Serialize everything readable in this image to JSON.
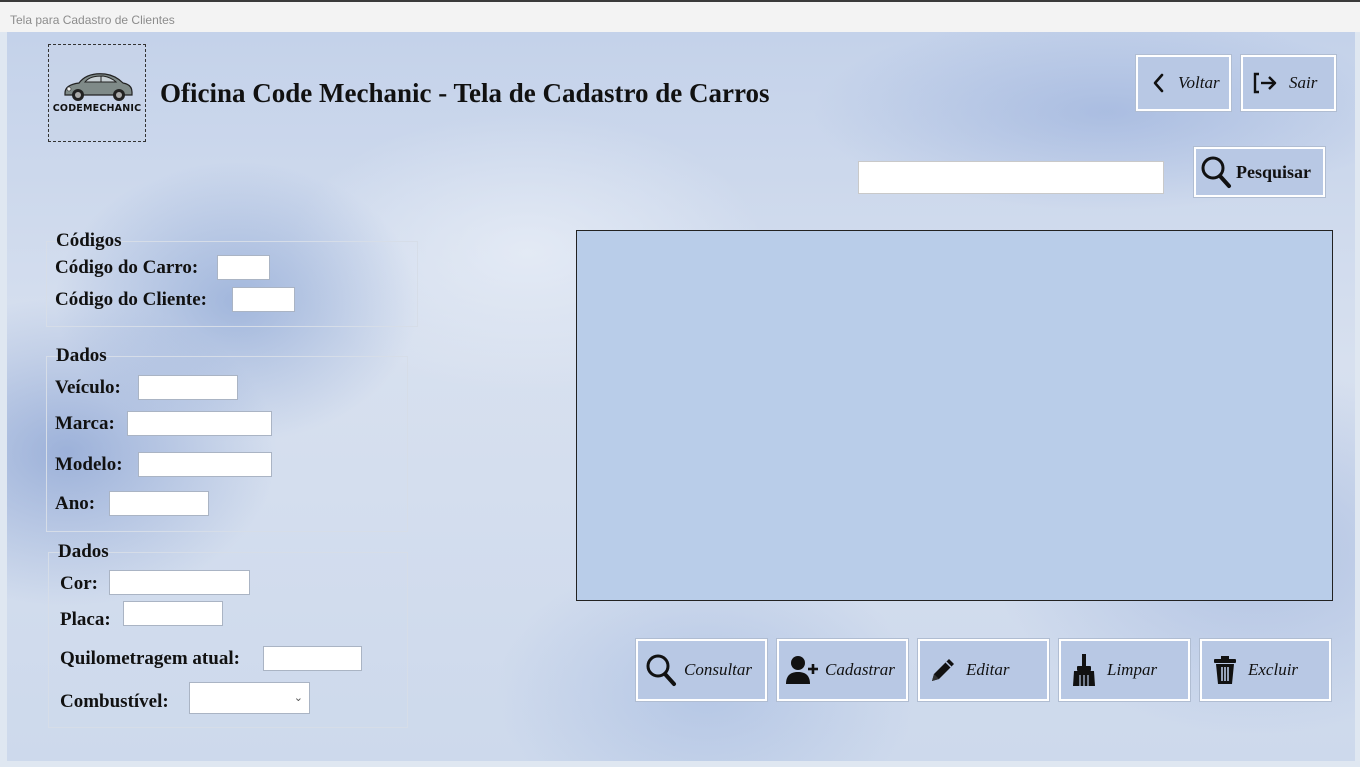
{
  "window": {
    "title": "Tela para Cadastro de Clientes"
  },
  "logo": {
    "text": "CODEMECHANIC"
  },
  "header": {
    "title": "Oficina Code Mechanic - Tela de Cadastro de Carros"
  },
  "nav": {
    "back_label": "Voltar",
    "exit_label": "Sair"
  },
  "search": {
    "value": "",
    "button_label": "Pesquisar"
  },
  "groups": {
    "codigos": {
      "legend": "Códigos",
      "car_code_label": "Código do Carro:",
      "car_code_value": "",
      "client_code_label": "Código do Cliente:",
      "client_code_value": ""
    },
    "dados1": {
      "legend": "Dados",
      "vehicle_label": "Veículo:",
      "vehicle_value": "",
      "brand_label": "Marca:",
      "brand_value": "",
      "model_label": "Modelo:",
      "model_value": "",
      "year_label": "Ano:",
      "year_value": ""
    },
    "dados2": {
      "legend": "Dados",
      "color_label": "Cor:",
      "color_value": "",
      "plate_label": "Placa:",
      "plate_value": "",
      "mileage_label": "Quilometragem atual:",
      "mileage_value": "",
      "fuel_label": "Combustível:",
      "fuel_value": ""
    }
  },
  "actions": {
    "consultar": "Consultar",
    "cadastrar": "Cadastrar",
    "editar": "Editar",
    "limpar": "Limpar",
    "excluir": "Excluir"
  },
  "icons": {
    "back": "chevron-left-icon",
    "exit": "sign-out-icon",
    "search": "magnifier-icon",
    "add_user": "user-plus-icon",
    "edit": "pencil-icon",
    "clear": "broom-icon",
    "delete": "trash-icon"
  },
  "colors": {
    "button_bg": "#b8c8e4",
    "grid_bg": "#b9cde9",
    "text": "#111111"
  }
}
